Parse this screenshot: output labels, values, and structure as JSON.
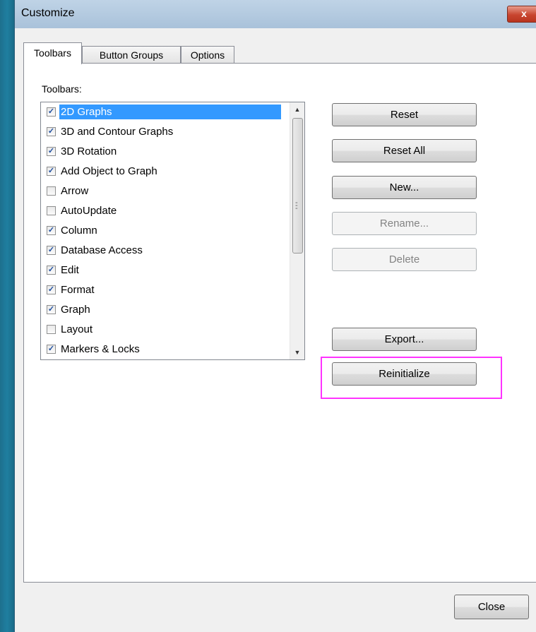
{
  "window": {
    "title": "Customize",
    "close_glyph": "x"
  },
  "tabs": [
    {
      "label": "Toolbars"
    },
    {
      "label": "Button Groups"
    },
    {
      "label": "Options"
    }
  ],
  "toolbars_label": "Toolbars:",
  "toolbar_list": [
    {
      "label": "2D Graphs",
      "checked": true,
      "selected": true
    },
    {
      "label": "3D and Contour Graphs",
      "checked": true
    },
    {
      "label": "3D Rotation",
      "checked": true
    },
    {
      "label": "Add Object to Graph",
      "checked": true
    },
    {
      "label": "Arrow",
      "checked": false
    },
    {
      "label": "AutoUpdate",
      "checked": false
    },
    {
      "label": "Column",
      "checked": true
    },
    {
      "label": "Database Access",
      "checked": true
    },
    {
      "label": "Edit",
      "checked": true
    },
    {
      "label": "Format",
      "checked": true
    },
    {
      "label": "Graph",
      "checked": true
    },
    {
      "label": "Layout",
      "checked": false
    },
    {
      "label": "Markers & Locks",
      "checked": true
    }
  ],
  "buttons": {
    "reset": "Reset",
    "reset_all": "Reset All",
    "new": "New...",
    "rename": "Rename...",
    "delete": "Delete",
    "export": "Export...",
    "reinitialize": "Reinitialize",
    "close": "Close"
  },
  "colors": {
    "selection": "#3399ff",
    "highlight_box": "#ff33ff"
  }
}
